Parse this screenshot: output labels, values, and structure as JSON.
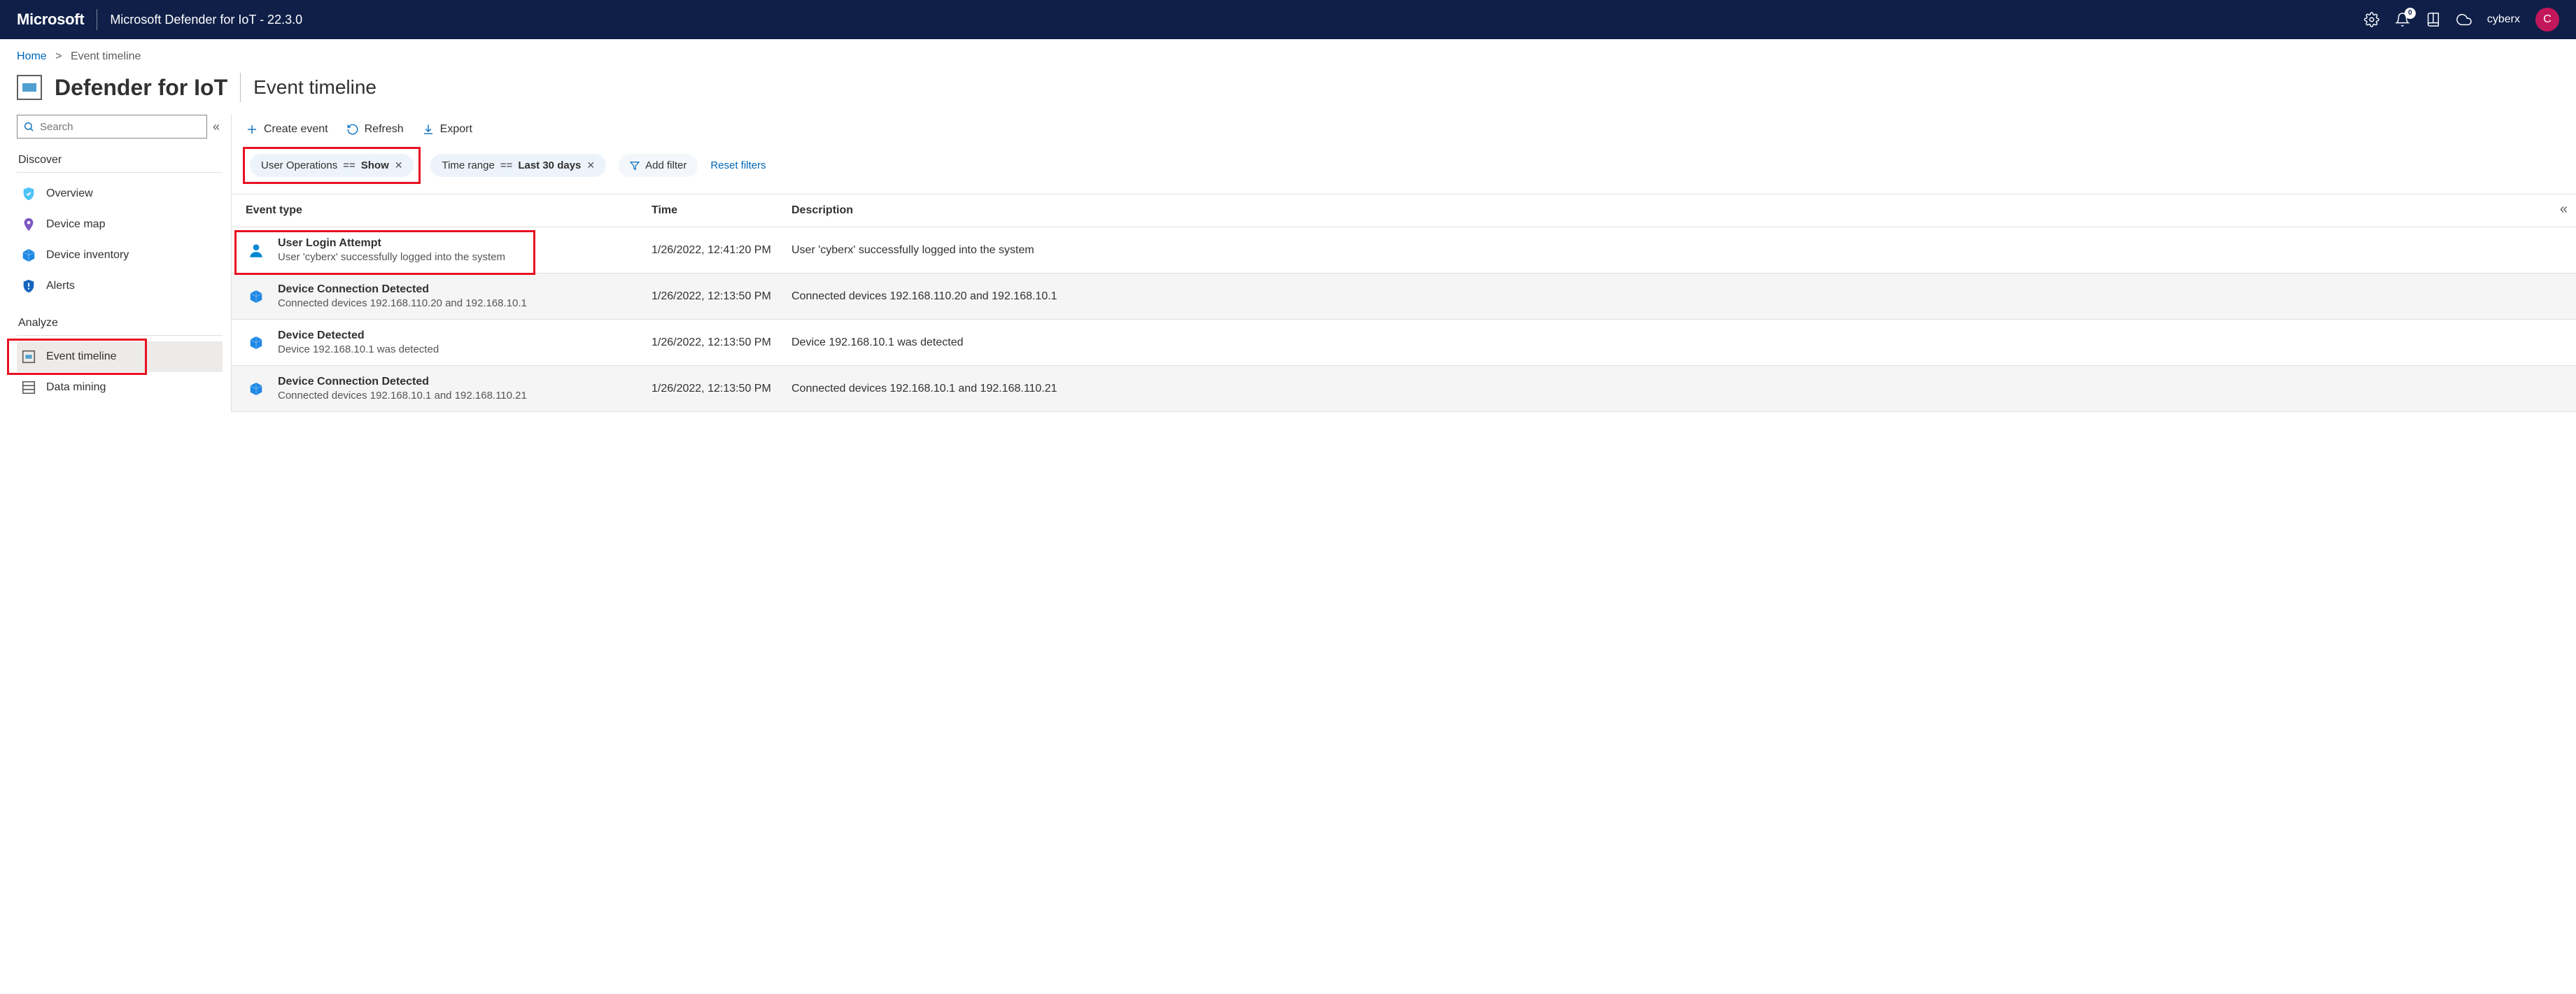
{
  "topbar": {
    "brand": "Microsoft",
    "app_title": "Microsoft Defender for IoT - 22.3.0",
    "bell_count": "0",
    "username": "cyberx",
    "avatar_initial": "C"
  },
  "breadcrumb": {
    "home": "Home",
    "current": "Event timeline"
  },
  "title": {
    "main": "Defender for IoT",
    "sub": "Event timeline"
  },
  "search": {
    "placeholder": "Search"
  },
  "nav": {
    "section_discover": "Discover",
    "section_analyze": "Analyze",
    "discover_items": [
      {
        "label": "Overview",
        "icon": "shield-check",
        "color": "#4fc3f7"
      },
      {
        "label": "Device map",
        "icon": "pin",
        "color": "#7e57c2"
      },
      {
        "label": "Device inventory",
        "icon": "cube",
        "color": "#1e88e5"
      },
      {
        "label": "Alerts",
        "icon": "shield-alert",
        "color": "#1565c0"
      }
    ],
    "analyze_items": [
      {
        "label": "Event timeline",
        "icon": "timeline",
        "active": true
      },
      {
        "label": "Data mining",
        "icon": "data",
        "active": false
      }
    ]
  },
  "toolbar": {
    "create_label": "Create event",
    "refresh_label": "Refresh",
    "export_label": "Export"
  },
  "filters": {
    "pill1_key": "User Operations",
    "pill1_op": "==",
    "pill1_val": "Show",
    "pill2_key": "Time range",
    "pill2_op": "==",
    "pill2_val": "Last 30 days",
    "add_label": "Add filter",
    "reset_label": "Reset filters"
  },
  "table": {
    "col_type": "Event type",
    "col_time": "Time",
    "col_desc": "Description",
    "rows": [
      {
        "icon": "user",
        "icon_color": "#0288d1",
        "title": "User Login Attempt",
        "sub": "User 'cyberx' successfully logged into the system",
        "time": "1/26/2022, 12:41:20 PM",
        "desc": "User 'cyberx' successfully logged into the system",
        "alt": false,
        "highlight": true
      },
      {
        "icon": "cube",
        "icon_color": "#1e88e5",
        "title": "Device Connection Detected",
        "sub": "Connected devices 192.168.110.20 and 192.168.10.1",
        "time": "1/26/2022, 12:13:50 PM",
        "desc": "Connected devices 192.168.110.20 and 192.168.10.1",
        "alt": true,
        "highlight": false
      },
      {
        "icon": "cube",
        "icon_color": "#1e88e5",
        "title": "Device Detected",
        "sub": "Device 192.168.10.1 was detected",
        "time": "1/26/2022, 12:13:50 PM",
        "desc": "Device 192.168.10.1 was detected",
        "alt": false,
        "highlight": false
      },
      {
        "icon": "cube",
        "icon_color": "#1e88e5",
        "title": "Device Connection Detected",
        "sub": "Connected devices 192.168.10.1 and 192.168.110.21",
        "time": "1/26/2022, 12:13:50 PM",
        "desc": "Connected devices 192.168.10.1 and 192.168.110.21",
        "alt": true,
        "highlight": false
      }
    ]
  }
}
